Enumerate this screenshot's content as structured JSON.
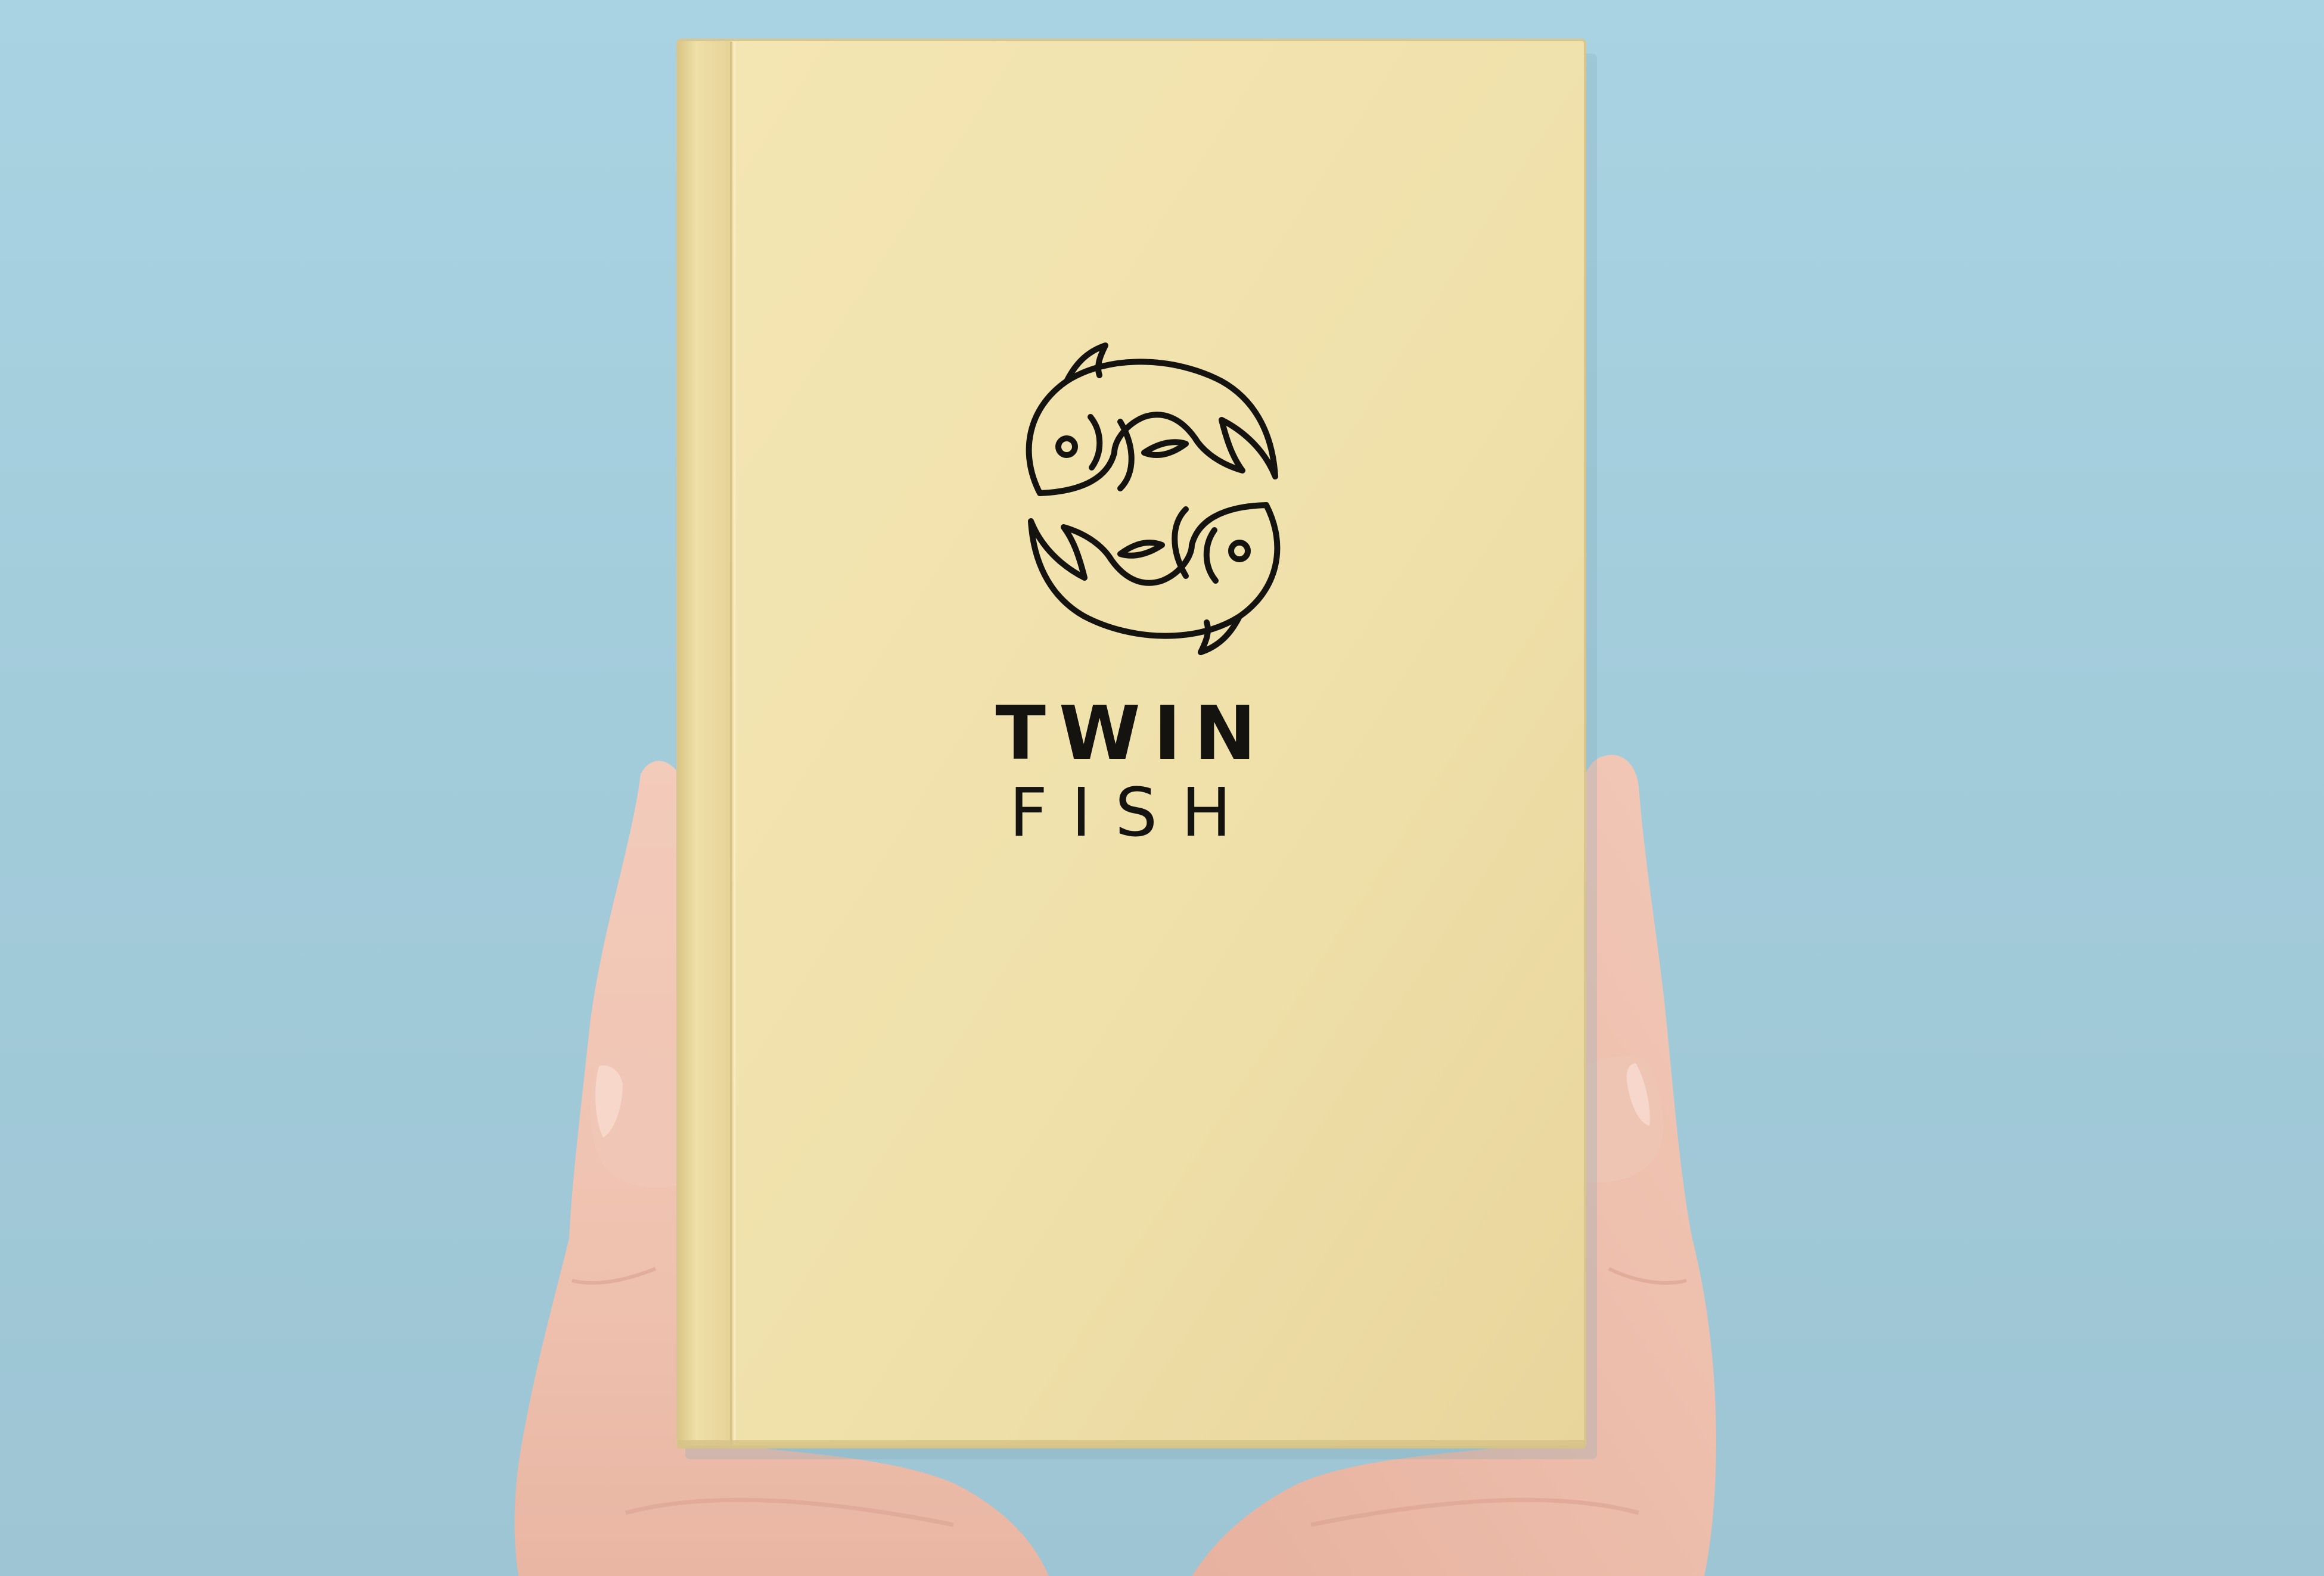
{
  "scene": {
    "background_color": "#a5cfde",
    "book_cover_color": "#f1e3af",
    "logo_color": "#141310",
    "description_icon": "twin-fish-logo-icon"
  },
  "logo": {
    "line1": "TWIN",
    "line2": "FISH"
  }
}
